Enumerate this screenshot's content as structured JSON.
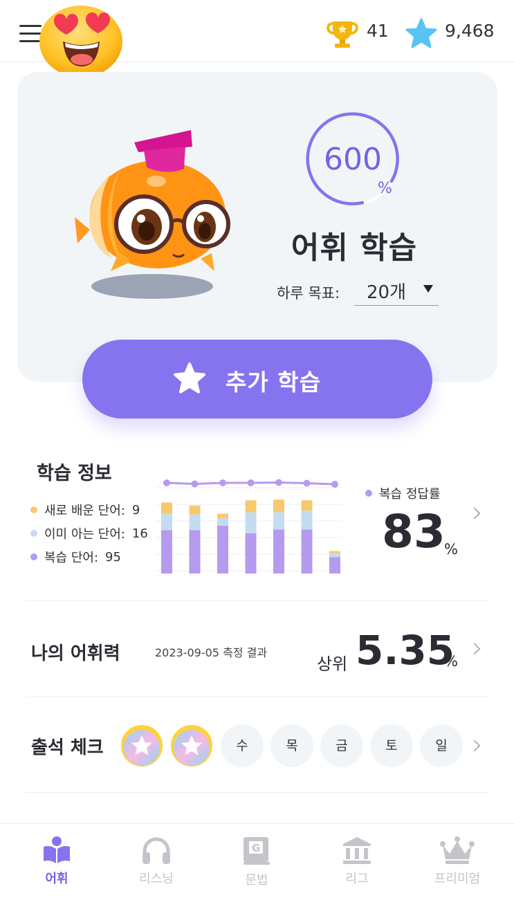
{
  "header": {
    "trophy_count": "41",
    "star_count": "9,468"
  },
  "hero": {
    "progress_value": "600",
    "progress_unit": "%",
    "title": "어휘 학습",
    "goal_label": "하루 목표:",
    "goal_value": "20개",
    "extra_button_label": "추가 학습"
  },
  "study_info": {
    "title": "학습 정보",
    "legend": [
      {
        "label": "새로 배운 단어:",
        "value": "9",
        "color": "#f7c96e"
      },
      {
        "label": "이미 아는 단어:",
        "value": "16",
        "color": "#c4dcf2"
      },
      {
        "label": "복습 단어:",
        "value": "95",
        "color": "#b59af0"
      }
    ],
    "accuracy_label": "복습 정답률",
    "accuracy_value": "83",
    "accuracy_unit": "%"
  },
  "chart_data": {
    "type": "bar",
    "stacked": true,
    "series": [
      {
        "values": [
          58,
          58,
          64,
          54,
          59,
          59,
          22
        ],
        "color": "#b59af0"
      },
      {
        "values": [
          22,
          21,
          10,
          28,
          23,
          25,
          5
        ],
        "color": "#c4dcf2"
      },
      {
        "values": [
          15,
          12,
          6,
          16,
          17,
          14,
          3
        ],
        "color": "#f7c96e"
      }
    ],
    "line": {
      "values": [
        90,
        87,
        90,
        90,
        91,
        89,
        86
      ],
      "color": "#b59af0"
    },
    "ylim": [
      0,
      100
    ],
    "grid": true
  },
  "vocab_level": {
    "title": "나의 어휘력",
    "date": "2023-09-05 측정 결과",
    "prefix": "상위",
    "value": "5.35",
    "unit": "%"
  },
  "attendance": {
    "title": "출석 체크",
    "days": [
      "수",
      "목",
      "금",
      "토",
      "일"
    ]
  },
  "nav": {
    "items": [
      {
        "label": "어휘"
      },
      {
        "label": "리스닝"
      },
      {
        "label": "문법"
      },
      {
        "label": "리그"
      },
      {
        "label": "프리미엄"
      }
    ]
  },
  "colors": {
    "accent": "#8574ee",
    "accent_text": "#7461e8",
    "inactive": "#c4c4ca"
  }
}
